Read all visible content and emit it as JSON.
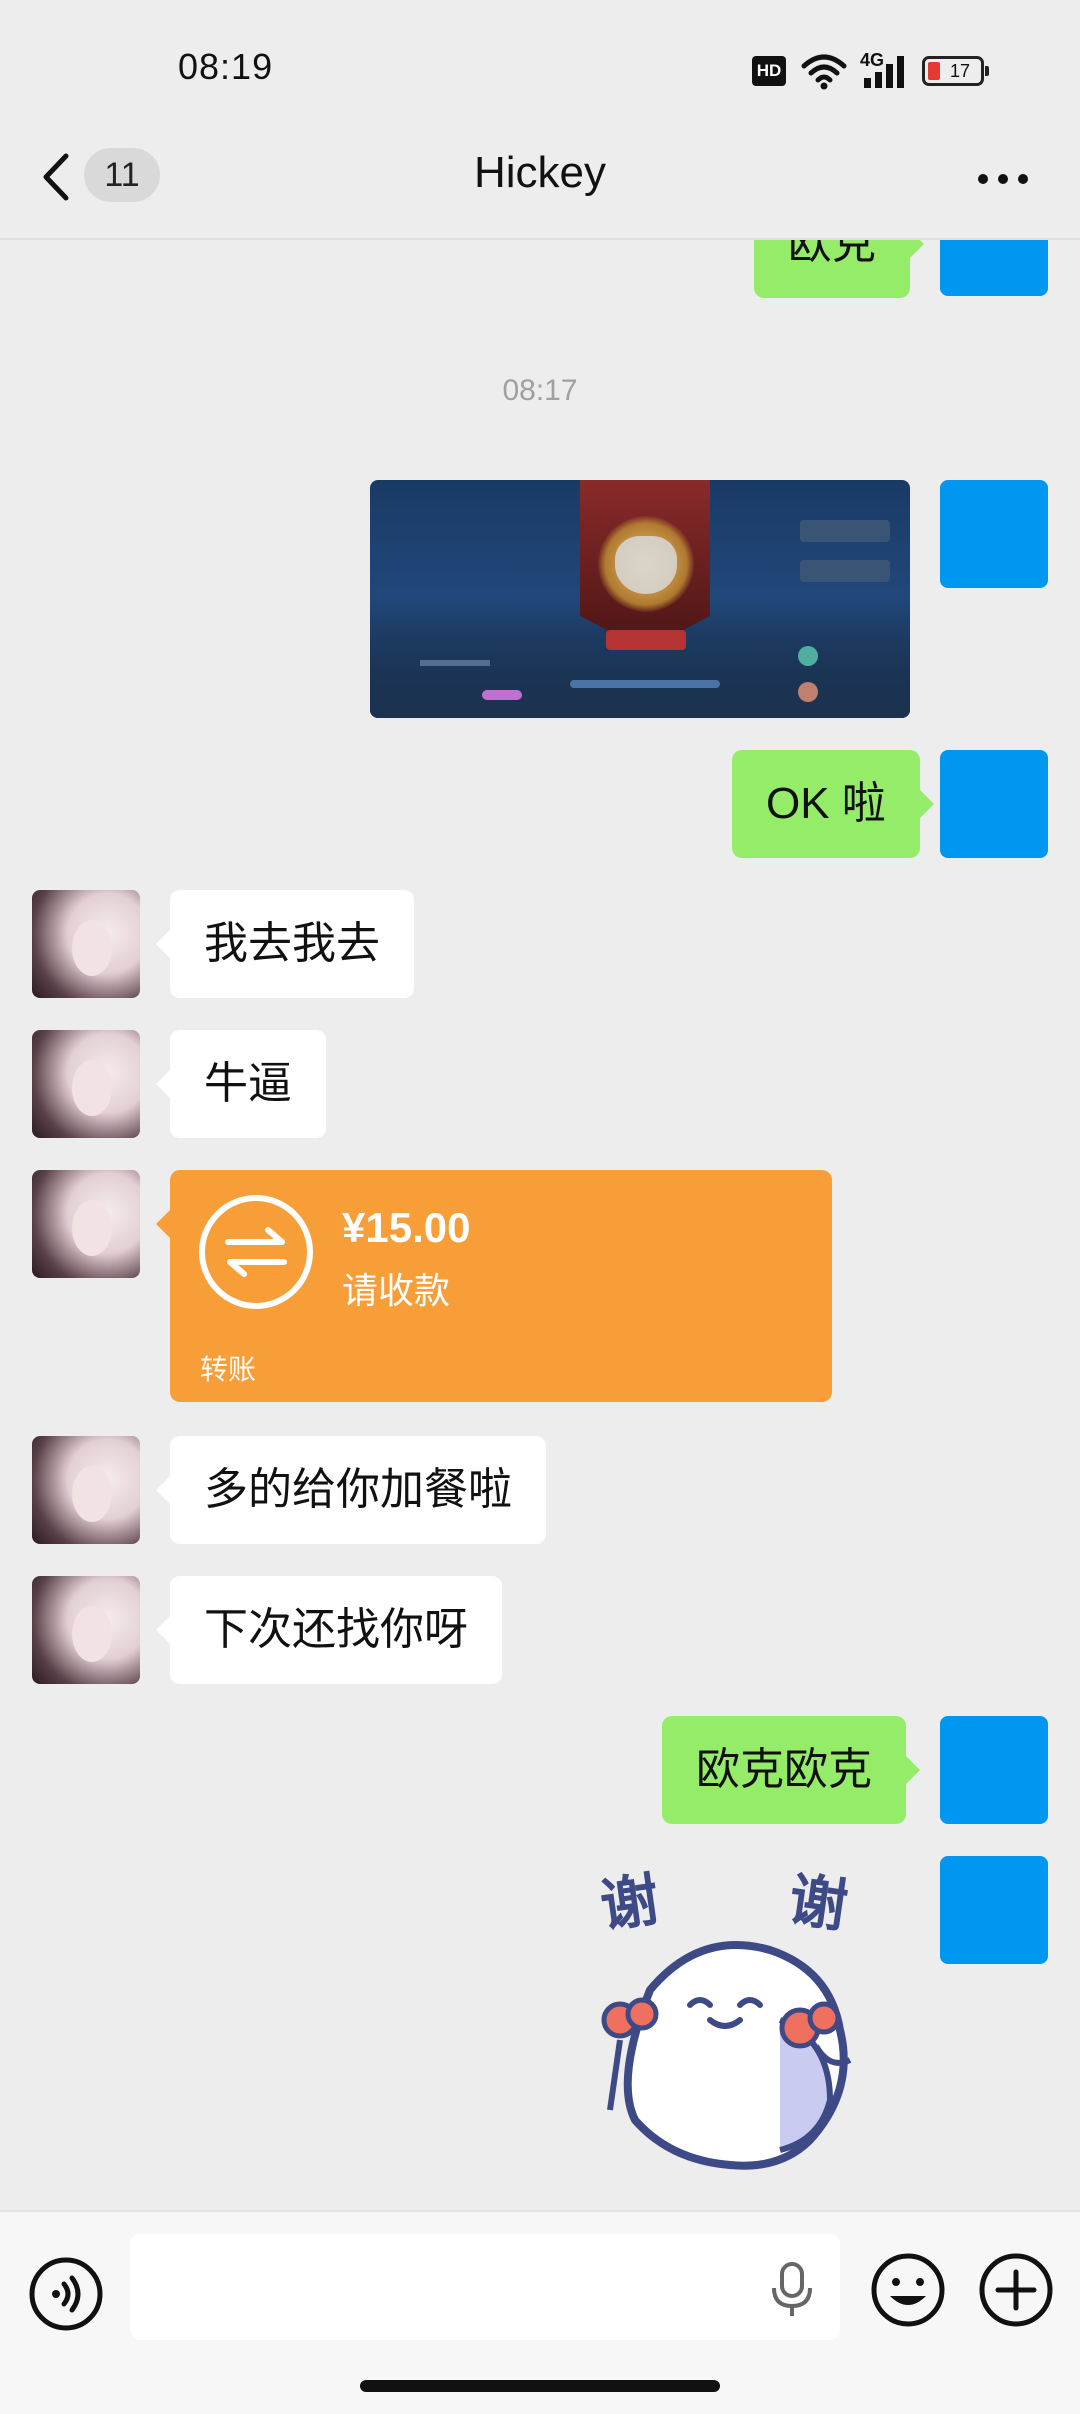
{
  "status_bar": {
    "time": "08:19",
    "hd_badge": "HD",
    "network": "4G",
    "battery_level": "17"
  },
  "header": {
    "unread_count": "11",
    "title": "Hickey"
  },
  "messages": {
    "partial_top": "欧克",
    "timestamp": "08:17",
    "ok_la": "OK 啦",
    "m1": "我去我去",
    "m2": "牛逼",
    "transfer": {
      "amount": "¥15.00",
      "status": "请收款",
      "label": "转账"
    },
    "m3": "多的给你加餐啦",
    "m4": "下次还找你呀",
    "okok": "欧克欧克",
    "sticker_text_left": "谢",
    "sticker_text_right": "谢"
  },
  "colors": {
    "my_bubble": "#95ec69",
    "transfer": "#f79e39",
    "my_avatar": "#0097f0"
  }
}
